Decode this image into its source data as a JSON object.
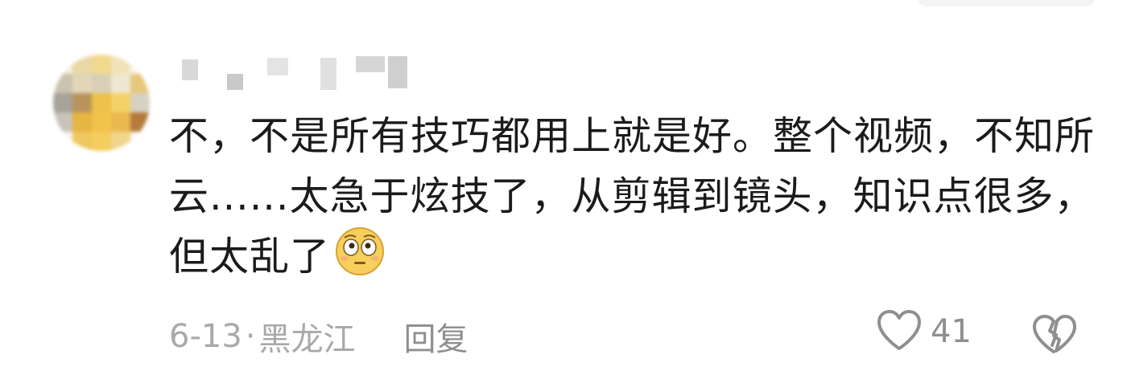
{
  "comment": {
    "text": "不，不是所有技巧都用上就是好。整个视频，不知所云......太急于炫技了，从剪辑到镜头，知识点很多，但太乱了",
    "emoji": "flushed-face-emoji"
  },
  "meta": {
    "date": "6-13",
    "separator": "·",
    "location": "黑龙江",
    "reply_label": "回复"
  },
  "actions": {
    "like_icon": "heart-outline-icon",
    "like_count": "41",
    "dislike_icon": "broken-heart-outline-icon"
  },
  "colors": {
    "text": "#1b1b1b",
    "meta": "#a9a9a9",
    "icon": "#8f8f8f",
    "background": "#ffffff"
  }
}
